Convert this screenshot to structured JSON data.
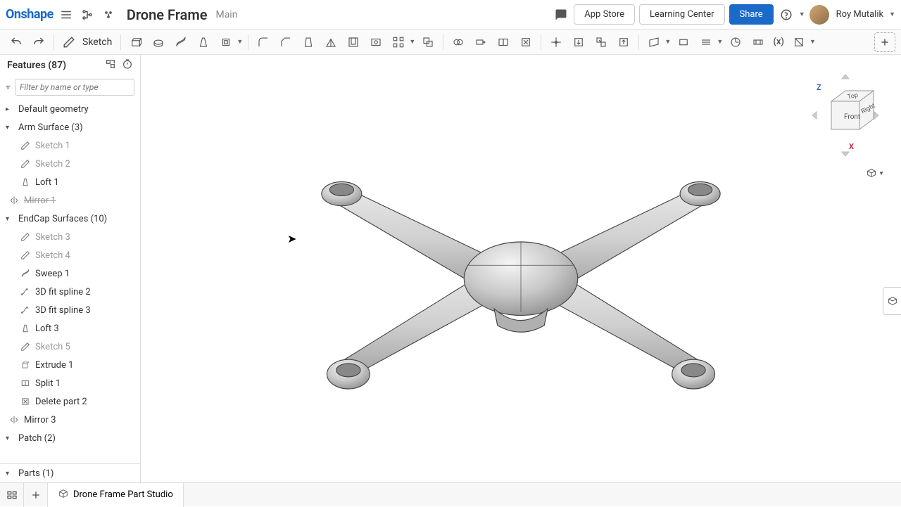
{
  "header": {
    "logo": "Onshape",
    "doc_title": "Drone Frame",
    "branch": "Main",
    "app_store": "App Store",
    "learning_center": "Learning Center",
    "share": "Share",
    "user_name": "Roy Mutalik"
  },
  "toolbar": {
    "sketch_label": "Sketch"
  },
  "sidebar": {
    "features_label": "Features (87)",
    "filter_placeholder": "Filter by name or type",
    "tree": [
      {
        "type": "group",
        "label": "Default geometry",
        "expanded": false,
        "icon": "caret"
      },
      {
        "type": "group",
        "label": "Arm Surface (3)",
        "expanded": true,
        "icon": "caret"
      },
      {
        "type": "child",
        "label": "Sketch 1",
        "icon": "sketch",
        "dim": true
      },
      {
        "type": "child",
        "label": "Sketch 2",
        "icon": "sketch",
        "dim": true
      },
      {
        "type": "child",
        "label": "Loft 1",
        "icon": "loft",
        "dim": false
      },
      {
        "type": "strike",
        "label": "Mirror 1",
        "icon": "mirror"
      },
      {
        "type": "group",
        "label": "EndCap Surfaces (10)",
        "expanded": true,
        "icon": "caret"
      },
      {
        "type": "child",
        "label": "Sketch 3",
        "icon": "sketch",
        "dim": true
      },
      {
        "type": "child",
        "label": "Sketch 4",
        "icon": "sketch",
        "dim": true
      },
      {
        "type": "child",
        "label": "Sweep 1",
        "icon": "sweep",
        "dim": false
      },
      {
        "type": "child",
        "label": "3D fit spline 2",
        "icon": "spline",
        "dim": false
      },
      {
        "type": "child",
        "label": "3D fit spline 3",
        "icon": "spline",
        "dim": false
      },
      {
        "type": "child",
        "label": "Loft 3",
        "icon": "loft",
        "dim": false
      },
      {
        "type": "child",
        "label": "Sketch 5",
        "icon": "sketch",
        "dim": true
      },
      {
        "type": "child",
        "label": "Extrude 1",
        "icon": "extrude",
        "dim": false
      },
      {
        "type": "child",
        "label": "Split 1",
        "icon": "split",
        "dim": false
      },
      {
        "type": "child",
        "label": "Delete part 2",
        "icon": "delete",
        "dim": false
      },
      {
        "type": "top",
        "label": "Mirror 3",
        "icon": "mirror"
      },
      {
        "type": "group",
        "label": "Patch (2)",
        "expanded": true,
        "icon": "caret"
      }
    ],
    "parts_label": "Parts (1)"
  },
  "viewcube": {
    "front": "Front",
    "right": "Right",
    "top": "Top",
    "x": "X",
    "z": "Z"
  },
  "bottombar": {
    "tab": "Drone Frame Part Studio"
  }
}
